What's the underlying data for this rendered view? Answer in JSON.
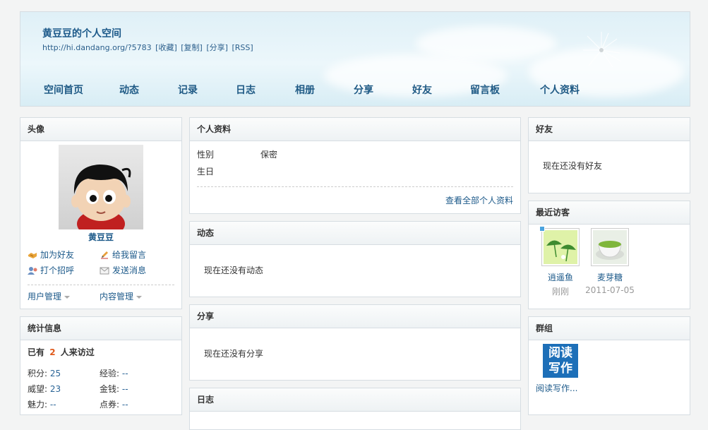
{
  "header": {
    "title": "黄豆豆的个人空间",
    "url": "http://hi.dandang.org/?5783",
    "links": [
      "[收藏]",
      "[复制]",
      "[分享]",
      "[RSS]"
    ]
  },
  "nav": [
    "空间首页",
    "动态",
    "记录",
    "日志",
    "相册",
    "分享",
    "好友",
    "留言板",
    "个人资料"
  ],
  "avatar_panel": {
    "title": "头像",
    "name": "黄豆豆",
    "actions": [
      "加为好友",
      "给我留言",
      "打个招呼",
      "发送消息"
    ],
    "manage": [
      "用户管理",
      "内容管理"
    ]
  },
  "stats_panel": {
    "title": "统计信息",
    "visit_prefix": "已有",
    "visit_count": "2",
    "visit_suffix": "人来访过",
    "items": [
      {
        "label": "积分:",
        "value": "25"
      },
      {
        "label": "经验:",
        "value": "--"
      },
      {
        "label": "威望:",
        "value": "23"
      },
      {
        "label": "金钱:",
        "value": "--"
      },
      {
        "label": "魅力:",
        "value": "--"
      },
      {
        "label": "点券:",
        "value": "--"
      }
    ]
  },
  "profile_panel": {
    "title": "个人资料",
    "gender_label": "性别",
    "gender_value": "保密",
    "birthday_label": "生日",
    "view_all": "查看全部个人资料"
  },
  "feed_panel": {
    "title": "动态",
    "empty": "现在还没有动态"
  },
  "share_panel": {
    "title": "分享",
    "empty": "现在还没有分享"
  },
  "blog_panel": {
    "title": "日志"
  },
  "friends_panel": {
    "title": "好友",
    "empty": "现在还没有好友"
  },
  "visitors_panel": {
    "title": "最近访客",
    "visitors": [
      {
        "name": "逍遥鱼",
        "time": "刚刚"
      },
      {
        "name": "麦芽糖",
        "time": "2011-07-05"
      }
    ]
  },
  "groups_panel": {
    "title": "群组",
    "group_name": "阅读写作...",
    "logo_text": "阅读写作"
  },
  "colors": {
    "accent": "#1d5a8a",
    "count": "#e05a1c",
    "header_bg": "#dff0f7"
  }
}
